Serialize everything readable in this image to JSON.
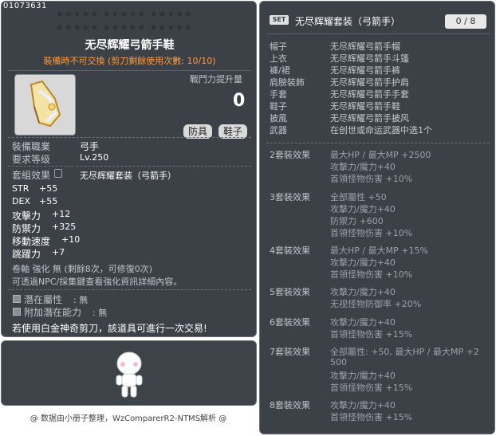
{
  "item": {
    "id": "01073631",
    "title": "无尽辉耀弓箭手鞋",
    "trade_notice": "裝備時不可交換 (剪刀剩餘使用次數: 10/10)",
    "power_label": "戰鬥力提升量",
    "power_value": "0",
    "tags": [
      "防具",
      "鞋子"
    ],
    "job_label": "裝備職業",
    "job_value": "弓手",
    "level_label": "要求等级",
    "level_value": "Lv.250",
    "set_label": "套組效果",
    "set_value": "无尽辉耀套装（弓箭手）",
    "stats": [
      {
        "name": "STR",
        "value": "+55"
      },
      {
        "name": "DEX",
        "value": "+55"
      },
      {
        "name": "攻擊力",
        "value": "+12"
      },
      {
        "name": "防禦力",
        "value": "+325"
      },
      {
        "name": "移動速度",
        "value": "+10"
      },
      {
        "name": "跳躍力",
        "value": "+7"
      }
    ],
    "scroll_line": "卷軸 強化 無 (剩餘8次，可修復0次)",
    "star_line": "可透過NPC/採集鍵查看強化資訊詳細內容。",
    "potential": {
      "label": "潛在屬性",
      "value": ": 無"
    },
    "bonus_potential": {
      "label": "附加潛在能力",
      "value": ": 無"
    },
    "scissors_note": "若使用白金神奇剪刀，該道具可進行一次交易!"
  },
  "footer": "@ 数据由小册子整理，WzComparerR2-NTMS解析 @",
  "set": {
    "badge": "SET",
    "name": "无尽辉耀套装（弓箭手）",
    "count": "0 / 8",
    "parts": [
      {
        "slot": "帽子",
        "name": "无尽辉耀弓箭手帽"
      },
      {
        "slot": "上衣",
        "name": "无尽辉耀弓箭手斗篷"
      },
      {
        "slot": "褲/裙",
        "name": "无尽辉耀弓箭手裤"
      },
      {
        "slot": "肩膀裝飾",
        "name": "无尽辉耀弓箭手护肩"
      },
      {
        "slot": "手套",
        "name": "无尽辉耀弓箭手手套"
      },
      {
        "slot": "鞋子",
        "name": "无尽辉耀弓箭手鞋"
      },
      {
        "slot": "披風",
        "name": "无尽辉耀弓箭手披风"
      },
      {
        "slot": "武器",
        "name": "在创世或命运武器中选1个"
      }
    ],
    "effects": [
      {
        "label": "2套裝效果",
        "lines": [
          "最大HP / 最大MP  +2500",
          "攻擊力/魔力+40",
          "首領怪物伤害 +10%"
        ]
      },
      {
        "label": "3套裝效果",
        "lines": [
          "全部屬性 +50",
          "攻擊力/魔力+40",
          "防禦力 +600",
          "首領怪物伤害 +10%"
        ]
      },
      {
        "label": "4套裝效果",
        "lines": [
          "最大HP / 最大MP  +15%",
          "攻擊力/魔力+40",
          "首領怪物伤害 +10%"
        ]
      },
      {
        "label": "5套裝效果",
        "lines": [
          "攻擊力/魔力+40",
          "无视怪物防御率 +20%"
        ]
      },
      {
        "label": "6套裝效果",
        "lines": [
          "攻擊力/魔力+40",
          "首領怪物伤害 +15%"
        ]
      },
      {
        "label": "7套裝效果",
        "lines": [
          "全部屬性: +50, 最大HP / 最大MP  +2",
          "500",
          "攻擊力/魔力+40",
          "首領怪物伤害 +15%"
        ]
      },
      {
        "label": "8套裝效果",
        "lines": [
          "攻擊力/魔力+40",
          "首領怪物伤害 +15%"
        ]
      }
    ]
  }
}
